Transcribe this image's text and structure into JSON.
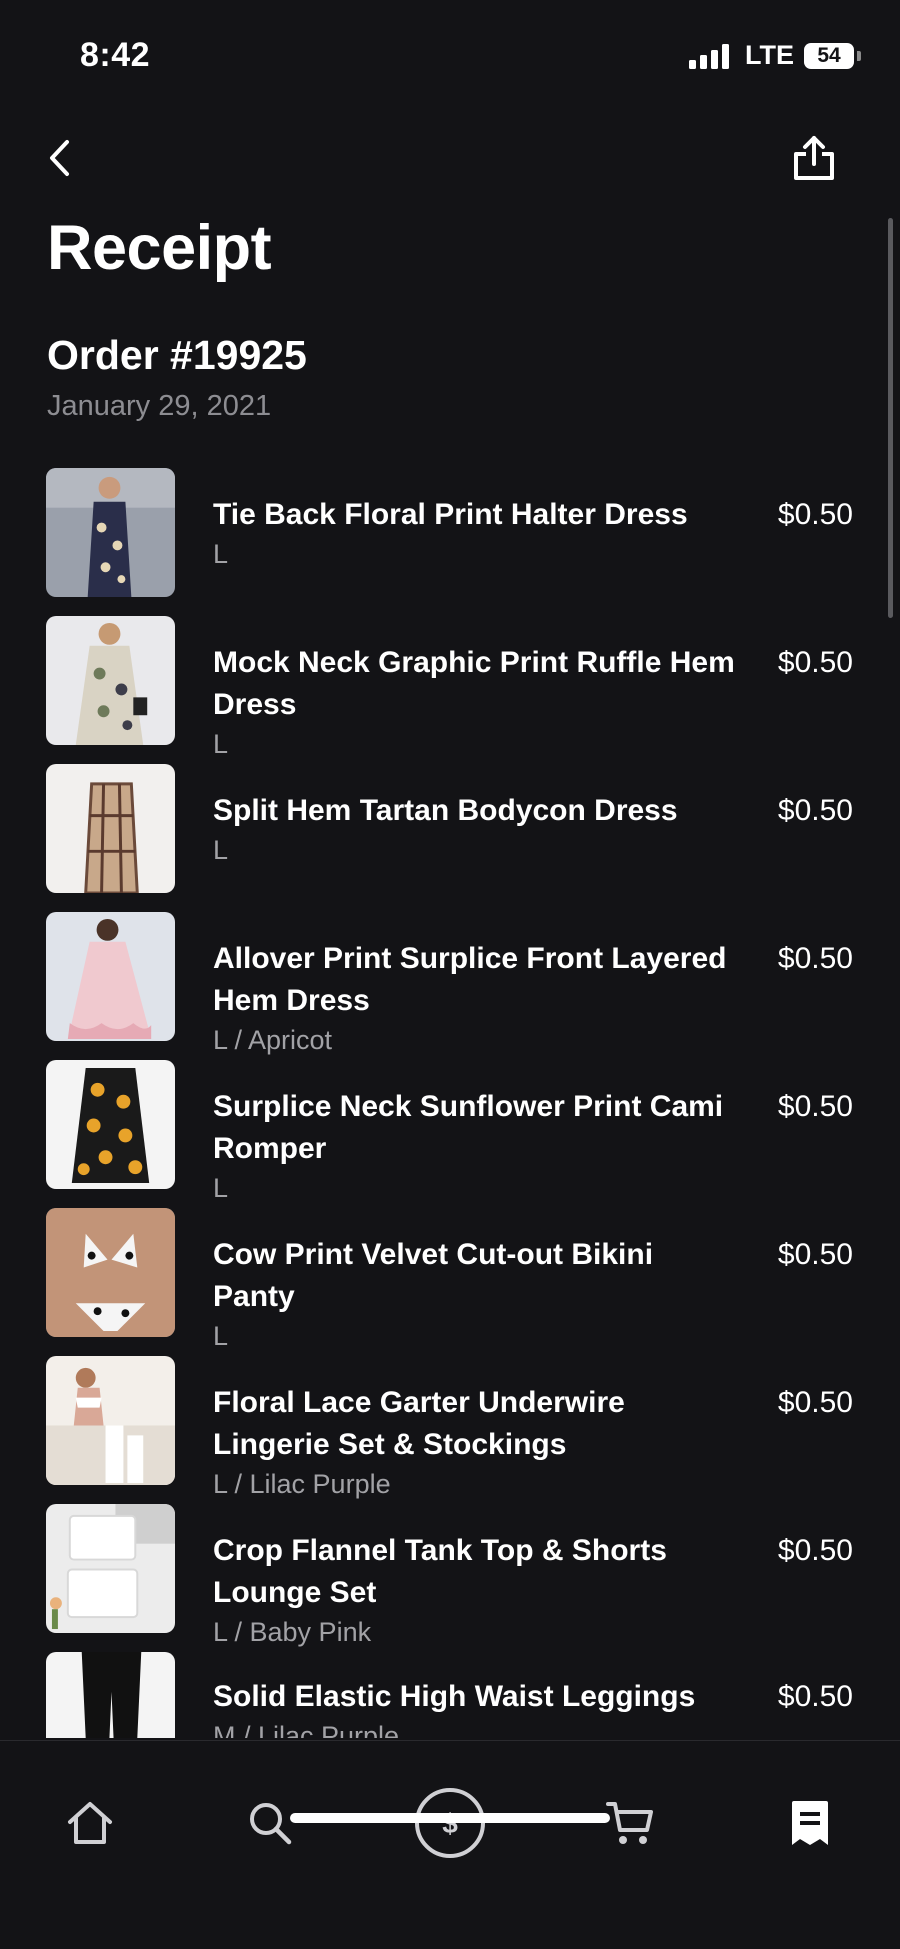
{
  "status_bar": {
    "time": "8:42",
    "network": "LTE",
    "battery": "54"
  },
  "header": {
    "back_icon": "chevron-left-icon",
    "share_icon": "share-icon",
    "title": "Receipt"
  },
  "order": {
    "number": "Order #19925",
    "date": "January 29, 2021"
  },
  "items": [
    {
      "name": "Tie Back Floral Print Halter Dress",
      "variant": "L",
      "price": "$0.50"
    },
    {
      "name": "Mock Neck Graphic Print Ruffle Hem Dress",
      "variant": "L",
      "price": "$0.50"
    },
    {
      "name": "Split Hem Tartan Bodycon Dress",
      "variant": "L",
      "price": "$0.50"
    },
    {
      "name": "Allover Print Surplice Front Layered Hem Dress",
      "variant": "L / Apricot",
      "price": "$0.50"
    },
    {
      "name": "Surplice Neck Sunflower Print Cami Romper",
      "variant": "L",
      "price": "$0.50"
    },
    {
      "name": "Cow Print Velvet Cut-out Bikini Panty",
      "variant": "L",
      "price": "$0.50"
    },
    {
      "name": "Floral Lace Garter Underwire Lingerie Set & Stockings",
      "variant": "L / Lilac Purple",
      "price": "$0.50"
    },
    {
      "name": "Crop Flannel Tank Top & Shorts Lounge Set",
      "variant": "L / Baby Pink",
      "price": "$0.50"
    },
    {
      "name": "Solid Elastic High Waist Leggings",
      "variant": "M / Lilac Purple",
      "price": "$0.50"
    }
  ],
  "tab_bar": {
    "tabs": [
      {
        "icon": "home-icon",
        "active": false
      },
      {
        "icon": "search-icon",
        "active": false
      },
      {
        "icon": "dollar-circle-icon",
        "active": false
      },
      {
        "icon": "cart-icon",
        "active": false
      },
      {
        "icon": "receipt-icon",
        "active": true
      }
    ]
  },
  "colors": {
    "background": "#131316",
    "text_primary": "#ffffff",
    "text_secondary": "#8d8d92"
  }
}
